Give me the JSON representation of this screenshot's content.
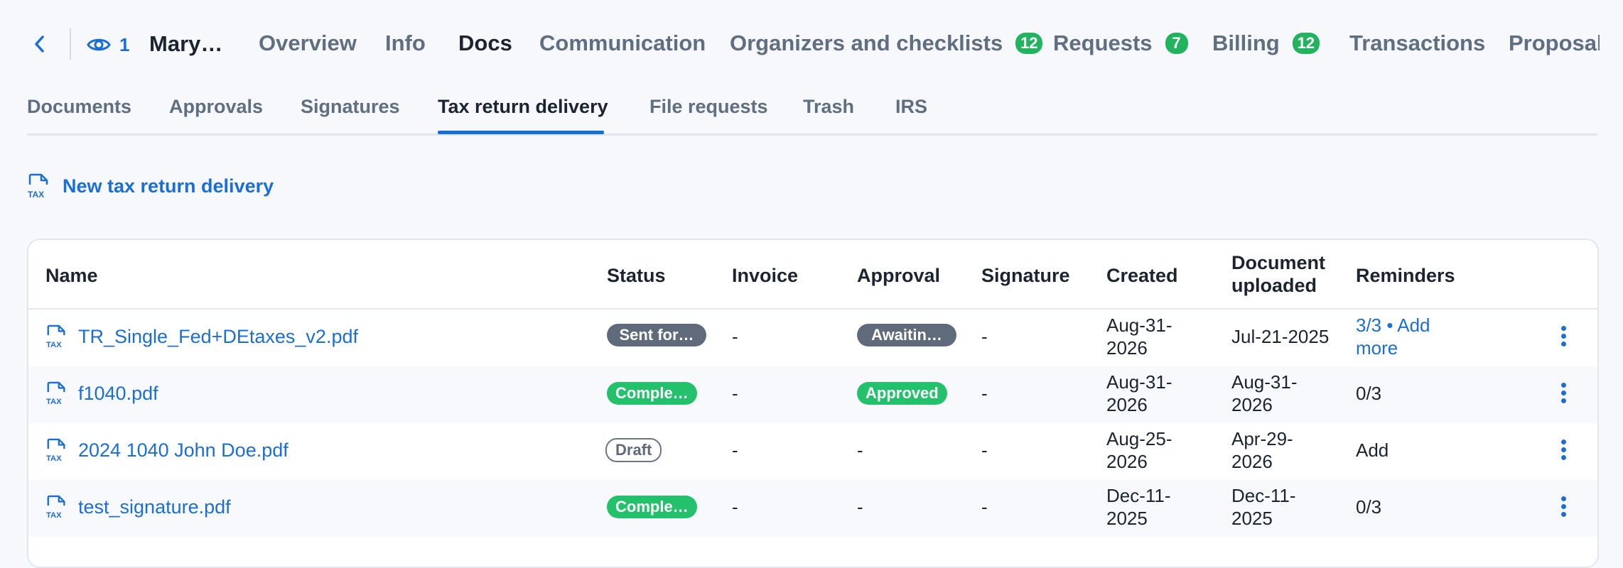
{
  "header": {
    "viewer_count": "1",
    "client_name": "Mary…",
    "tabs": [
      {
        "label": "Overview"
      },
      {
        "label": "Info"
      },
      {
        "label": "Docs"
      },
      {
        "label": "Communication"
      },
      {
        "label": "Organizers and checklists",
        "badge": "12"
      },
      {
        "label": "Requests",
        "badge": "7"
      },
      {
        "label": "Billing",
        "badge": "12"
      },
      {
        "label": "Transactions"
      },
      {
        "label": "Proposals"
      }
    ],
    "active_tab": "Docs"
  },
  "subtabs": {
    "items": [
      "Documents",
      "Approvals",
      "Signatures",
      "Tax return delivery",
      "File requests",
      "Trash",
      "IRS"
    ],
    "active": "Tax return delivery"
  },
  "new_delivery_label": "New tax return delivery",
  "icons": {
    "back": "chevron-left-icon",
    "viewers": "eye-icon",
    "tax_file": "tax-file-icon",
    "row_menu": "more-vertical-icon"
  },
  "colors": {
    "accent": "#1a6ed8",
    "green": "#23c16b",
    "gray_pill": "#5f6b7b",
    "text": "#1b2430"
  },
  "table": {
    "columns": {
      "name": "Name",
      "status": "Status",
      "invoice": "Invoice",
      "approval": "Approval",
      "signature": "Signature",
      "created": "Created",
      "doc_uploaded_1": "Document",
      "doc_uploaded_2": "uploaded",
      "reminders": "Reminders"
    },
    "rows": [
      {
        "name": "TR_Single_Fed+DEtaxes_v2.pdf",
        "status": "Sent for…",
        "invoice": "-",
        "approval": "Awaitin…",
        "signature": "-",
        "created_1": "Aug-31-",
        "created_2": "2026",
        "uploaded_1": "Jul-21-2025",
        "uploaded_2": "",
        "reminders_1": "3/3 • Add",
        "reminders_2": "more"
      },
      {
        "name": "f1040.pdf",
        "status": "Comple…",
        "invoice": "-",
        "approval": "Approved",
        "signature": "-",
        "created_1": "Aug-31-",
        "created_2": "2026",
        "uploaded_1": "Aug-31-",
        "uploaded_2": "2026",
        "reminders_1": "0/3",
        "reminders_2": ""
      },
      {
        "name": "2024 1040 John Doe.pdf",
        "status": "Draft",
        "invoice": "-",
        "approval": "-",
        "signature": "-",
        "created_1": "Aug-25-",
        "created_2": "2026",
        "uploaded_1": "Apr-29-",
        "uploaded_2": "2026",
        "reminders_1": "Add",
        "reminders_2": ""
      },
      {
        "name": "test_signature.pdf",
        "status": "Comple…",
        "invoice": "-",
        "approval": "-",
        "signature": "-",
        "created_1": "Dec-11-",
        "created_2": "2025",
        "uploaded_1": "Dec-11-",
        "uploaded_2": "2025",
        "reminders_1": "0/3",
        "reminders_2": ""
      }
    ]
  }
}
